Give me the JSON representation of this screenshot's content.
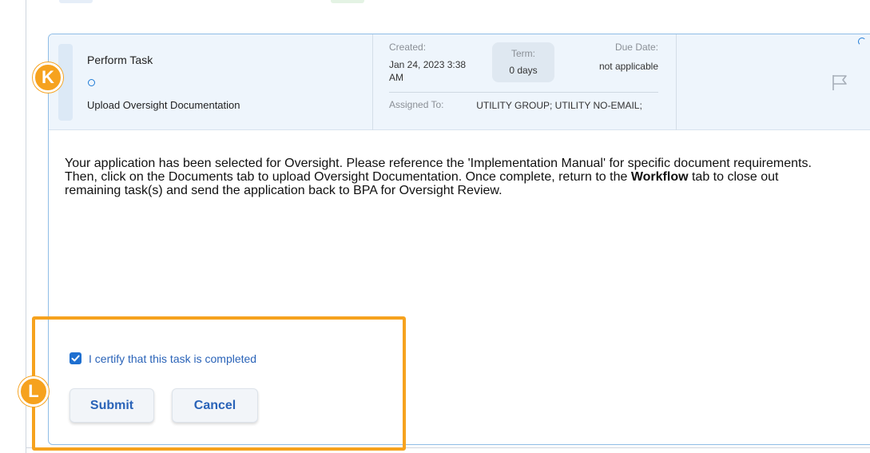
{
  "task": {
    "title": "Perform Task",
    "subtitle": "Upload Oversight Documentation",
    "created_label": "Created:",
    "created_value": "Jan 24, 2023 3:38 AM",
    "term_label": "Term:",
    "term_value": "0 days",
    "due_label": "Due Date:",
    "due_value": "not applicable",
    "assigned_label": "Assigned To:",
    "assigned_value": "UTILITY GROUP; UTILITY NO-EMAIL;"
  },
  "description": {
    "part1": "Your application has been selected for Oversight. Please reference the 'Implementation Manual' for specific document requirements. Then, click on the Documents tab to upload Oversight Documentation. Once complete, return to the ",
    "bold": "Workflow",
    "part2": " tab to close out remaining task(s) and send the application back to BPA for Oversight Review."
  },
  "certify": {
    "label": "I certify that this task is completed",
    "checked": true
  },
  "buttons": {
    "submit": "Submit",
    "cancel": "Cancel"
  },
  "annotations": {
    "marker_k": "K",
    "marker_l": "L",
    "color": "#f6a21e"
  },
  "colors": {
    "accent": "#1e6fd0",
    "link_text": "#2a63b8",
    "card_border": "#8fbde6",
    "header_bg": "#eef5fc"
  }
}
